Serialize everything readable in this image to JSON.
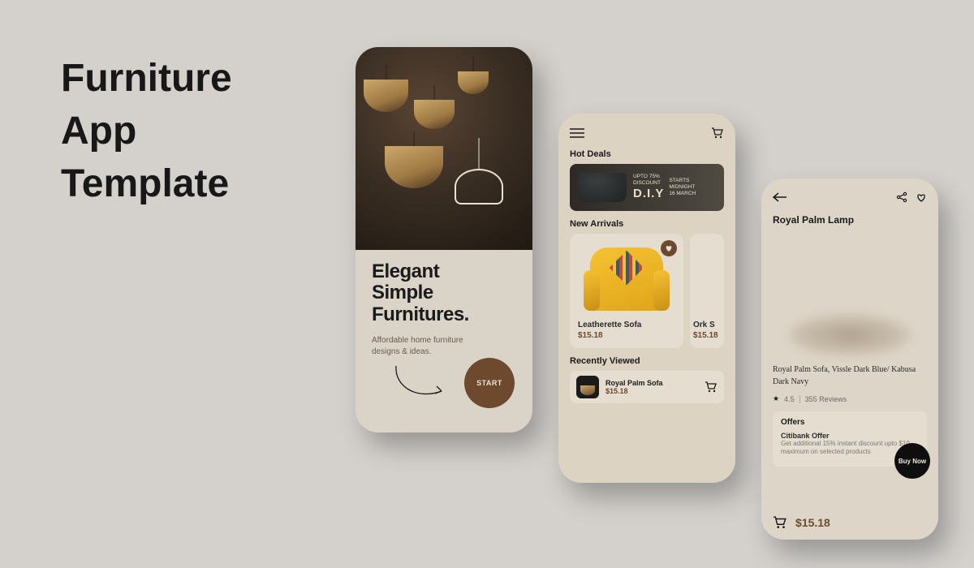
{
  "hero": {
    "line1": "Furniture",
    "line2": "App",
    "line3": "Template"
  },
  "screen1": {
    "headline_l1": "Elegant",
    "headline_l2": "Simple",
    "headline_l3": "Furnitures.",
    "sub_l1": "Affordable home furniture",
    "sub_l2": "designs & ideas.",
    "start_label": "START"
  },
  "screen2": {
    "hot_deals_title": "Hot Deals",
    "deal": {
      "upto": "UPTO 75%",
      "discount": "DISCOUNT",
      "diy": "D.I.Y",
      "starts": "STARTS",
      "midnight": "MIDNIGHT",
      "date": "16 MARCH"
    },
    "new_arrivals_title": "New Arrivals",
    "products": [
      {
        "name": "Leatherette Sofa",
        "price": "$15.18"
      },
      {
        "name": "Ork S",
        "price": "$15.18"
      }
    ],
    "recently_viewed_title": "Recently Viewed",
    "recent": {
      "name": "Royal Palm Sofa",
      "price": "$15.18"
    }
  },
  "screen3": {
    "title": "Royal Palm Lamp",
    "desc": "Royal Palm Sofa, Vissle Dark Blue/ Kabusa Dark Navy",
    "rating": "4.5",
    "reviews": "355 Reviews",
    "offers_title": "Offers",
    "offer_name": "Citibank Offer",
    "offer_body": "Get additional 15% instant discount upto $10 maximum on selected products",
    "buy_now": "Buy Now",
    "price": "$15.18"
  }
}
